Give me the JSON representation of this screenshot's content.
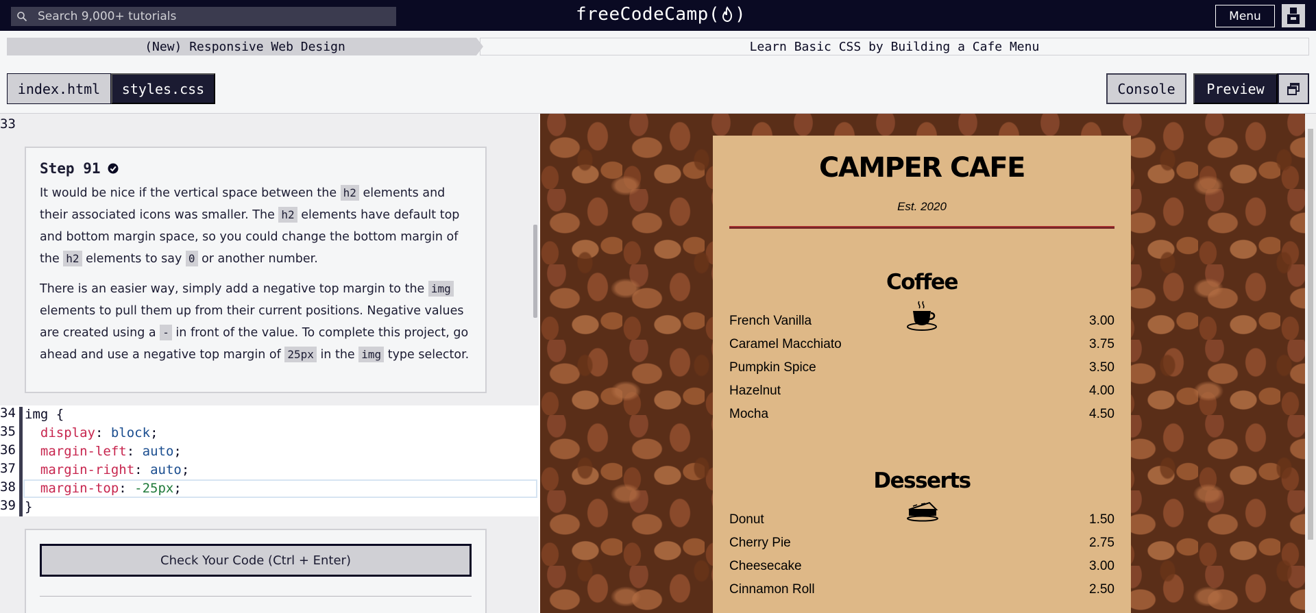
{
  "topnav": {
    "search_placeholder": "Search 9,000+ tutorials",
    "logo_text_left": "freeCodeCamp(",
    "logo_text_right": ")",
    "menu_label": "Menu"
  },
  "breadcrumb": {
    "superblock": "(New) Responsive Web Design",
    "block": "Learn Basic CSS by Building a Cafe Menu"
  },
  "tabs": {
    "files": [
      {
        "label": "index.html",
        "active": false
      },
      {
        "label": "styles.css",
        "active": true
      }
    ],
    "console_label": "Console",
    "preview_label": "Preview"
  },
  "editor": {
    "line_numbers": [
      "33",
      "34",
      "35",
      "36",
      "37",
      "38",
      "39"
    ],
    "step": {
      "title": "Step 91",
      "p1_a": "It would be nice if the vertical space between the ",
      "p1_code1": "h2",
      "p1_b": " elements and their associated icons was smaller. The ",
      "p1_code2": "h2",
      "p1_c": " elements have default top and bottom margin space, so you could change the bottom margin of the ",
      "p1_code3": "h2",
      "p1_d": " elements to say ",
      "p1_code4": "0",
      "p1_e": " or another number.",
      "p2_a": "There is an easier way, simply add a negative top margin to the ",
      "p2_code1": "img",
      "p2_b": " elements to pull them up from their current positions. Negative values are created using a ",
      "p2_code2": "-",
      "p2_c": " in front of the value. To complete this project, go ahead and use a negative top margin of ",
      "p2_code3": "25px",
      "p2_d": " in the ",
      "p2_code4": "img",
      "p2_e": " type selector."
    },
    "code": {
      "selector": "img",
      "open_brace": " {",
      "close_brace": "}",
      "declarations": [
        {
          "prop": "display",
          "value": "block",
          "num": false
        },
        {
          "prop": "margin-left",
          "value": "auto",
          "num": false
        },
        {
          "prop": "margin-right",
          "value": "auto",
          "num": false
        },
        {
          "prop": "margin-top",
          "value": "-25px",
          "num": true
        }
      ]
    },
    "check_button": "Check Your Code (Ctrl + Enter)"
  },
  "preview": {
    "title": "CAMPER CAFE",
    "established": "Est. 2020",
    "sections": [
      {
        "title": "Coffee",
        "icon": "coffee-cup-icon",
        "items": [
          {
            "name": "French Vanilla",
            "price": "3.00"
          },
          {
            "name": "Caramel Macchiato",
            "price": "3.75"
          },
          {
            "name": "Pumpkin Spice",
            "price": "3.50"
          },
          {
            "name": "Hazelnut",
            "price": "4.00"
          },
          {
            "name": "Mocha",
            "price": "4.50"
          }
        ]
      },
      {
        "title": "Desserts",
        "icon": "pie-slice-icon",
        "items": [
          {
            "name": "Donut",
            "price": "1.50"
          },
          {
            "name": "Cherry Pie",
            "price": "2.75"
          },
          {
            "name": "Cheesecake",
            "price": "3.00"
          },
          {
            "name": "Cinnamon Roll",
            "price": "2.50"
          }
        ]
      }
    ]
  },
  "colors": {
    "nav_bg": "#0a0a23",
    "tab_active_bg": "#1b1b32",
    "card_bg": "#deb887",
    "hr_color": "#792727",
    "css_property": "#c7254e",
    "css_value": "#1a4d8f"
  }
}
